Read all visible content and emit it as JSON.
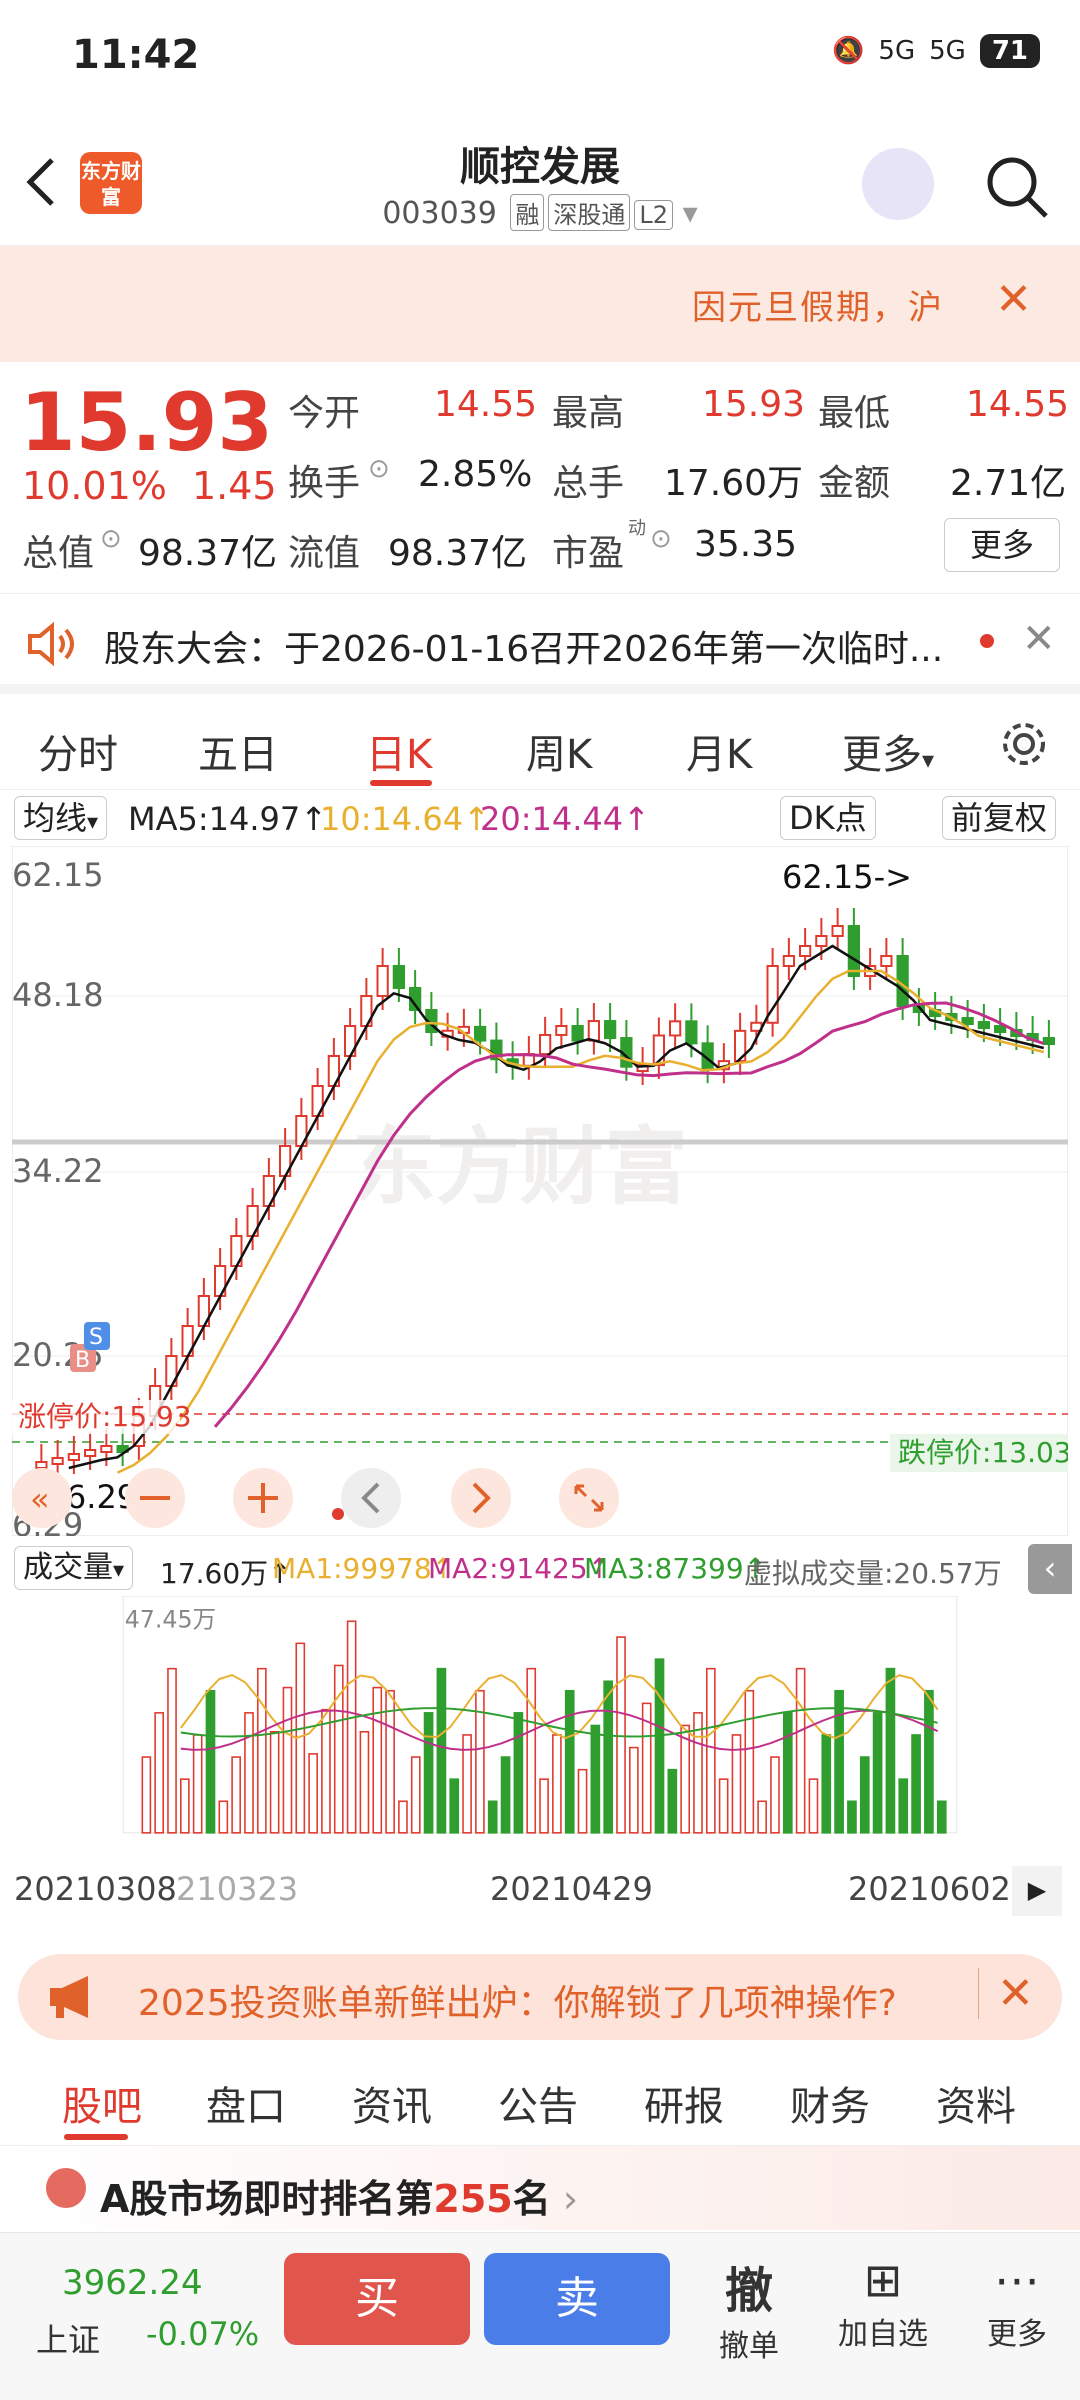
{
  "status": {
    "time": "11:42",
    "battery": "71",
    "signal1": "5G",
    "signal2": "5G"
  },
  "header": {
    "title": "顺控发展",
    "code": "003039",
    "tags": [
      "融",
      "深股通",
      "L2"
    ],
    "logo": "东方财富"
  },
  "notice": {
    "text": "因元旦假期，沪"
  },
  "quote": {
    "price": "15.93",
    "change_pct": "10.01%",
    "change": "1.45",
    "open_label": "今开",
    "open": "14.55",
    "high_label": "最高",
    "high": "15.93",
    "low_label": "最低",
    "low": "14.55",
    "turnover_label": "换手",
    "turnover": "2.85%",
    "volume_label": "总手",
    "volume": "17.60万",
    "amount_label": "金额",
    "amount": "2.71亿",
    "mcap_label": "总值",
    "mcap": "98.37亿",
    "float_label": "流值",
    "float": "98.37亿",
    "pe_label": "市盈",
    "pe_sup": "动",
    "pe": "35.35",
    "more": "更多"
  },
  "announce": {
    "text": "股东大会：于2026-01-16召开2026年第一次临时..."
  },
  "tabs": [
    "分时",
    "五日",
    "日K",
    "周K",
    "月K",
    "更多"
  ],
  "ma": {
    "selector": "均线",
    "ma5": "MA5:14.97",
    "ma10": "10:14.64",
    "ma20": "20:14.44",
    "dk": "DK点",
    "adjust": "前复权"
  },
  "chart_data": {
    "type": "candlestick",
    "ylabels": [
      "62.15",
      "48.18",
      "34.22",
      "20.25",
      "6.29"
    ],
    "max_label": "62.15->",
    "min_label": "<--6.29",
    "limit_up": "涨停价:15.93",
    "limit_down": "跌停价:13.03",
    "markers": [
      "B",
      "S"
    ],
    "x_dates": [
      "20210308",
      "210323",
      "20210429",
      "20210602"
    ],
    "watermark": "东方财富"
  },
  "volume": {
    "selector": "成交量",
    "v": "17.60万",
    "ma1": "MA1:99978",
    "ma2": "MA2:91425",
    "ma3": "MA3:87399",
    "virtual": "虚拟成交量:20.57万",
    "ymax": "47.45万"
  },
  "promo": {
    "text": "2025投资账单新鲜出炉：你解锁了几项神操作?"
  },
  "bottom_tabs": [
    "股吧",
    "盘口",
    "资讯",
    "公告",
    "研报",
    "财务",
    "资料"
  ],
  "rank": {
    "prefix": "A股市场即时排名第",
    "num": "255",
    "suffix": "名"
  },
  "bottombar": {
    "index_value": "3962.24",
    "index_name": "上证",
    "index_change": "-0.07%",
    "buy": "买",
    "sell": "卖",
    "cancel": "撤",
    "cancel_label": "撤单",
    "watch_label": "加自选",
    "more_label": "更多"
  }
}
